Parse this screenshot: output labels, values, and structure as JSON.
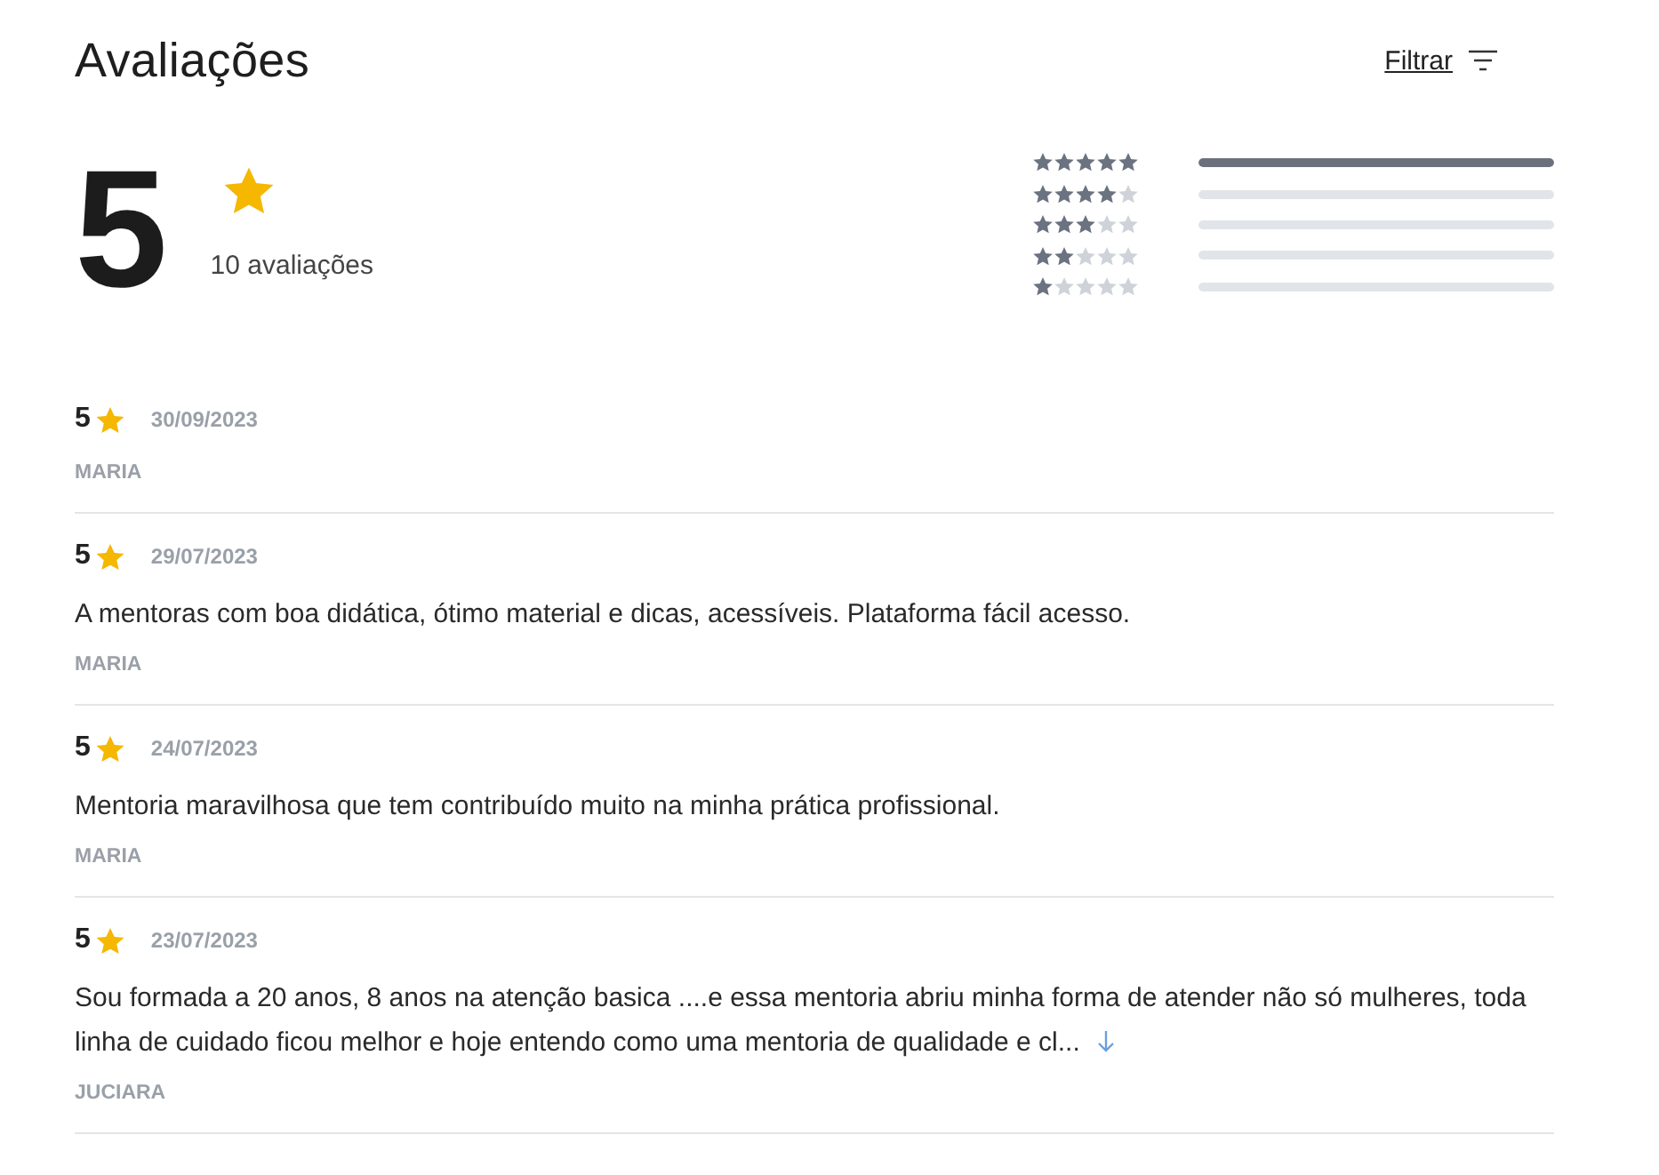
{
  "title": "Avaliações",
  "filter": {
    "label": "Filtrar"
  },
  "summary": {
    "score": "5",
    "count": "10 avaliações"
  },
  "distribution": [
    {
      "stars": 5,
      "level": 1
    },
    {
      "stars": 4,
      "level": 0
    },
    {
      "stars": 3,
      "level": 0
    },
    {
      "stars": 2,
      "level": 0
    },
    {
      "stars": 1,
      "level": 0
    }
  ],
  "reviews": [
    {
      "rating": "5",
      "date": "30/09/2023",
      "author": "MARIA"
    },
    {
      "rating": "5",
      "date": "29/07/2023",
      "text": "A mentoras com boa didática, ótimo material e dicas, acessíveis. Plataforma fácil acesso.",
      "author": "MARIA"
    },
    {
      "rating": "5",
      "date": "24/07/2023",
      "text": "Mentoria maravilhosa que tem contribuído muito na minha prática profissional.",
      "author": "MARIA"
    },
    {
      "rating": "5",
      "date": "23/07/2023",
      "text": "Sou formada a 20 anos, 8 anos na atenção basica ....e essa mentoria abriu minha forma de atender não só mulheres, toda linha de cuidado ficou melhor e hoje entendo como uma mentoria de qualidade e cl...",
      "truncated": true,
      "author": "JUCIARA"
    }
  ]
}
